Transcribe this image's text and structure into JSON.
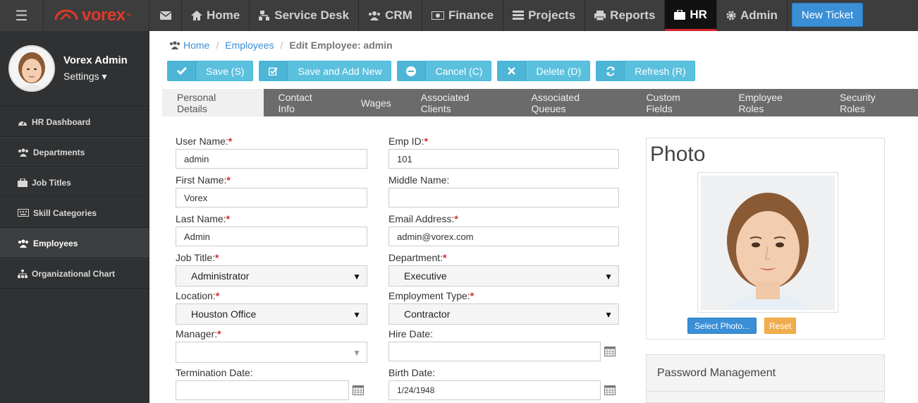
{
  "topnav": {
    "logo_text": "vorex",
    "logo_tm": "™",
    "items": [
      {
        "label": "Home"
      },
      {
        "label": "Service Desk"
      },
      {
        "label": "CRM"
      },
      {
        "label": "Finance"
      },
      {
        "label": "Projects"
      },
      {
        "label": "Reports"
      },
      {
        "label": "HR"
      },
      {
        "label": "Admin"
      }
    ],
    "active": "HR",
    "new_ticket": "New Ticket"
  },
  "sidebar": {
    "user_name": "Vorex Admin",
    "settings_label": "Settings",
    "items": [
      {
        "label": "HR Dashboard"
      },
      {
        "label": "Departments"
      },
      {
        "label": "Job Titles"
      },
      {
        "label": "Skill Categories"
      },
      {
        "label": "Employees"
      },
      {
        "label": "Organizational Chart"
      }
    ],
    "active": "Employees"
  },
  "breadcrumb": {
    "home": "Home",
    "employees": "Employees",
    "current": "Edit Employee: admin"
  },
  "toolbar": {
    "save": "Save (S)",
    "save_add": "Save and Add New",
    "cancel": "Cancel (C)",
    "delete": "Delete (D)",
    "refresh": "Refresh (R)"
  },
  "tabs": [
    {
      "label": "Personal Details"
    },
    {
      "label": "Contact Info"
    },
    {
      "label": "Wages"
    },
    {
      "label": "Associated Clients"
    },
    {
      "label": "Associated Queues"
    },
    {
      "label": "Custom Fields"
    },
    {
      "label": "Employee Roles"
    },
    {
      "label": "Security Roles"
    }
  ],
  "form": {
    "required_mark": "*",
    "user_name": {
      "label": "User Name:",
      "value": "admin"
    },
    "emp_id": {
      "label": "Emp ID:",
      "value": "101"
    },
    "first_name": {
      "label": "First Name:",
      "value": "Vorex"
    },
    "middle_name": {
      "label": "Middle Name:",
      "value": ""
    },
    "last_name": {
      "label": "Last Name:",
      "value": "Admin"
    },
    "email": {
      "label": "Email Address:",
      "value": "admin@vorex.com"
    },
    "job_title": {
      "label": "Job Title:",
      "value": "Administrator"
    },
    "department": {
      "label": "Department:",
      "value": "Executive"
    },
    "location": {
      "label": "Location:",
      "value": "Houston Office"
    },
    "employment_type": {
      "label": "Employment Type:",
      "value": "Contractor"
    },
    "manager": {
      "label": "Manager:",
      "value": ""
    },
    "hire_date": {
      "label": "Hire Date:",
      "value": ""
    },
    "termination_date": {
      "label": "Termination Date:",
      "value": ""
    },
    "birth_date": {
      "label": "Birth Date:",
      "value": "1/24/1948"
    }
  },
  "photo": {
    "title": "Photo",
    "select_btn": "Select Photo...",
    "reset_btn": "Reset"
  },
  "password": {
    "title": "Password Management"
  },
  "colors": {
    "accent": "#3a8fd6",
    "toolbar_btn": "#5bc0de",
    "brand_red": "#d9272e",
    "nav_bg": "#3d3d3d"
  }
}
